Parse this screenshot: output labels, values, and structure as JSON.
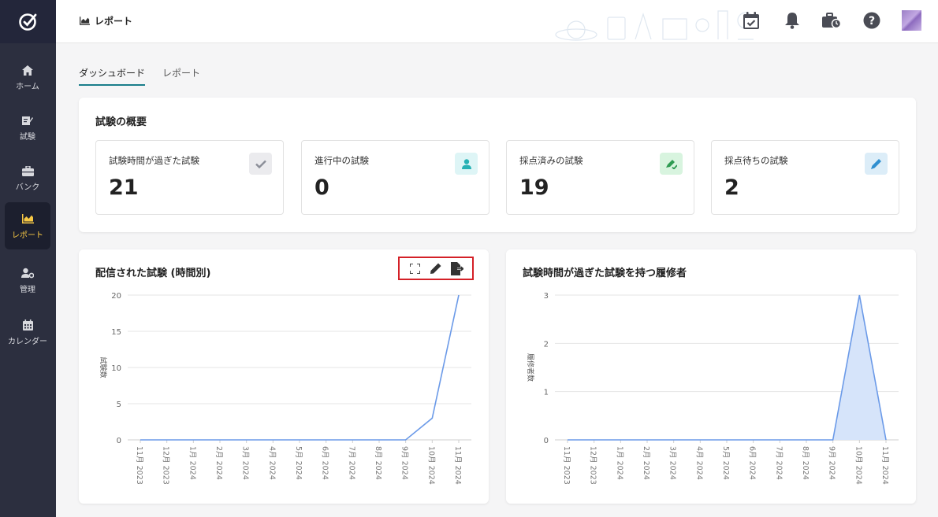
{
  "sidebar": {
    "items": [
      {
        "label": "ホーム",
        "icon": "home-icon"
      },
      {
        "label": "試験",
        "icon": "exam-edit-icon"
      },
      {
        "label": "バンク",
        "icon": "briefcase-icon"
      },
      {
        "label": "レポート",
        "icon": "chart-icon",
        "active": true
      },
      {
        "label": "管理",
        "icon": "user-gear-icon"
      },
      {
        "label": "カレンダー",
        "icon": "calendar-icon"
      }
    ]
  },
  "header": {
    "title": "レポート"
  },
  "tabs": [
    {
      "label": "ダッシュボード",
      "active": true
    },
    {
      "label": "レポート",
      "active": false
    }
  ],
  "overview": {
    "title": "試験の概要",
    "stats": [
      {
        "label": "試験時間が過ぎた試験",
        "value": "21",
        "icon": "check-icon",
        "bg": "#ebebee",
        "fg": "#8b8e98"
      },
      {
        "label": "進行中の試験",
        "value": "0",
        "icon": "person-icon",
        "bg": "#def5f6",
        "fg": "#27b1b4"
      },
      {
        "label": "採点済みの試験",
        "value": "19",
        "icon": "pen-check-icon",
        "bg": "#d8f4df",
        "fg": "#2e9b52"
      },
      {
        "label": "採点待ちの試験",
        "value": "2",
        "icon": "pen-icon",
        "bg": "#dcedf8",
        "fg": "#2f8fd0"
      }
    ]
  },
  "chart1": {
    "title": "配信された試験 (時間別)",
    "tools": [
      "fullscreen-icon",
      "edit-icon",
      "export-icon"
    ]
  },
  "chart2": {
    "title": "試験時間が過ぎた試験を持つ履修者"
  },
  "chart_data": [
    {
      "type": "line",
      "title": "配信された試験 (時間別)",
      "xlabel": "",
      "ylabel": "試験数",
      "categories": [
        "11月 2023",
        "12月 2023",
        "1月 2024",
        "2月 2024",
        "3月 2024",
        "4月 2024",
        "5月 2024",
        "6月 2024",
        "7月 2024",
        "8月 2024",
        "9月 2024",
        "10月 2024",
        "11月 2024"
      ],
      "values": [
        0,
        0,
        0,
        0,
        0,
        0,
        0,
        0,
        0,
        0,
        0,
        3,
        20
      ],
      "ylim": [
        0,
        20
      ],
      "yticks": [
        0,
        5,
        10,
        15,
        20
      ],
      "color": "#6b9ae8",
      "grid": true
    },
    {
      "type": "area",
      "title": "試験時間が過ぎた試験を持つ履修者",
      "xlabel": "",
      "ylabel": "履修者数",
      "categories": [
        "11月 2023",
        "12月 2023",
        "1月 2024",
        "2月 2024",
        "3月 2024",
        "4月 2024",
        "5月 2024",
        "6月 2024",
        "7月 2024",
        "8月 2024",
        "9月 2024",
        "10月 2024",
        "11月 2024"
      ],
      "values": [
        0,
        0,
        0,
        0,
        0,
        0,
        0,
        0,
        0,
        0,
        0,
        3,
        0
      ],
      "ylim": [
        0,
        3
      ],
      "yticks": [
        0,
        1,
        2,
        3
      ],
      "color": "#6b9ae8",
      "fill": "#d6e4fa",
      "grid": true
    }
  ]
}
